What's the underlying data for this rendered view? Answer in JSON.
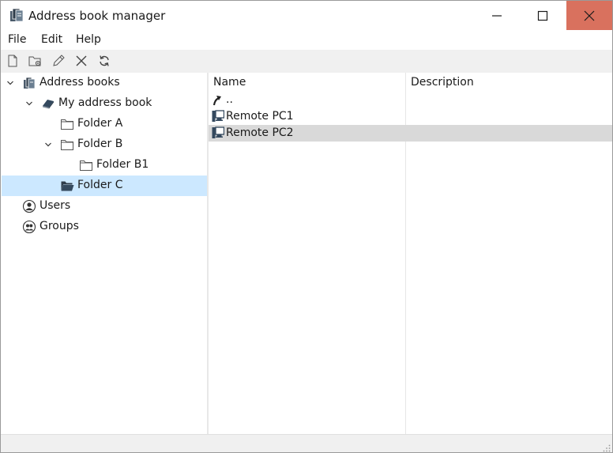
{
  "window": {
    "title": "Address book manager",
    "close_color": "#d9715e"
  },
  "menu": [
    {
      "label": "File"
    },
    {
      "label": "Edit"
    },
    {
      "label": "Help"
    }
  ],
  "toolbar": [
    {
      "icon": "new-document-icon"
    },
    {
      "icon": "new-folder-icon"
    },
    {
      "icon": "edit-pencil-icon"
    },
    {
      "icon": "delete-x-icon"
    },
    {
      "icon": "refresh-icon"
    }
  ],
  "tree": {
    "selected_color": "#cce8ff",
    "items": [
      {
        "label": "Address books",
        "icon": "address-books-icon",
        "expanded": true
      },
      {
        "label": "My address book",
        "icon": "book-icon",
        "expanded": true
      },
      {
        "label": "Folder A",
        "icon": "folder-icon"
      },
      {
        "label": "Folder B",
        "icon": "folder-icon",
        "expanded": true
      },
      {
        "label": "Folder B1",
        "icon": "folder-icon"
      },
      {
        "label": "Folder C",
        "icon": "folder-open-icon",
        "selected": true
      },
      {
        "label": "Users",
        "icon": "user-icon"
      },
      {
        "label": "Groups",
        "icon": "group-icon"
      }
    ]
  },
  "list": {
    "columns": [
      {
        "label": "Name"
      },
      {
        "label": "Description"
      }
    ],
    "rows": [
      {
        "name": "..",
        "icon": "up-arrow-icon"
      },
      {
        "name": "Remote PC1",
        "icon": "computer-icon"
      },
      {
        "name": "Remote PC2",
        "icon": "computer-icon",
        "selected": true
      }
    ],
    "selected_color": "#d9d9d9"
  }
}
